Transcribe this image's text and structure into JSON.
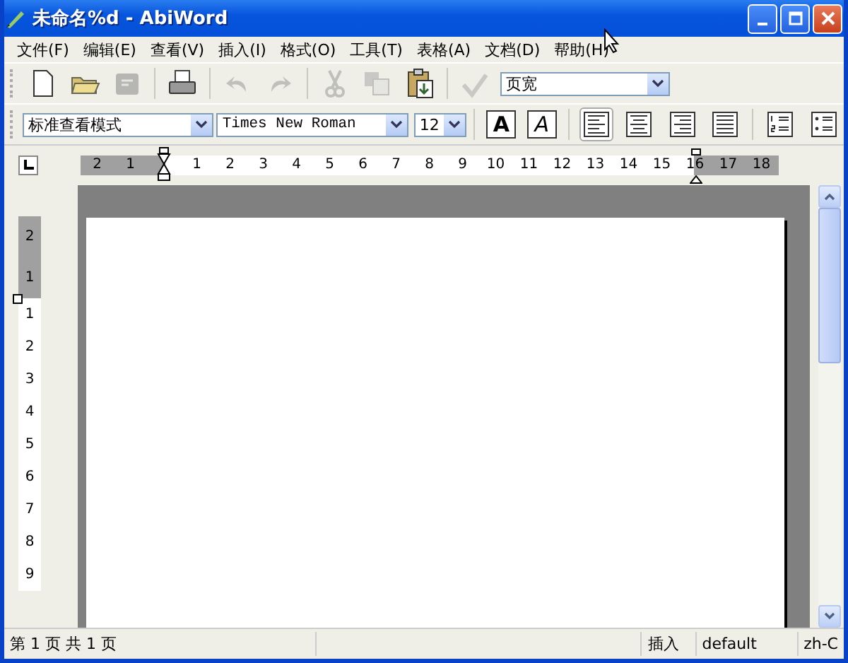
{
  "window": {
    "title": "未命名%d - AbiWord"
  },
  "menu": [
    {
      "label": "文件(F)"
    },
    {
      "label": "编辑(E)"
    },
    {
      "label": "查看(V)"
    },
    {
      "label": "插入(I)"
    },
    {
      "label": "格式(O)"
    },
    {
      "label": "工具(T)"
    },
    {
      "label": "表格(A)"
    },
    {
      "label": "文档(D)"
    },
    {
      "label": "帮助(H)"
    }
  ],
  "standard_toolbar": {
    "buttons": [
      {
        "kind": "new",
        "disabled": false
      },
      {
        "kind": "open",
        "disabled": false
      },
      {
        "kind": "save",
        "disabled": true
      },
      {
        "kind": "print",
        "disabled": false
      },
      {
        "kind": "undo",
        "disabled": true
      },
      {
        "kind": "redo",
        "disabled": true
      },
      {
        "kind": "cut",
        "disabled": true
      },
      {
        "kind": "copy",
        "disabled": true
      },
      {
        "kind": "paste",
        "disabled": false
      },
      {
        "kind": "spell",
        "disabled": true
      }
    ],
    "zoom": "页宽"
  },
  "format_toolbar": {
    "style": "标准查看模式",
    "font": "Times New Roman",
    "size": "12",
    "bold": "A",
    "italic": "A",
    "align": [
      {
        "kind": "left",
        "selected": true
      },
      {
        "kind": "center",
        "selected": false
      },
      {
        "kind": "right",
        "selected": false
      },
      {
        "kind": "justify",
        "selected": false
      }
    ],
    "lists": [
      {
        "kind": "numbered"
      },
      {
        "kind": "bulleted"
      }
    ]
  },
  "horizontal_ruler": {
    "before": [
      "2",
      "1"
    ],
    "after": [
      "1",
      "2",
      "3",
      "4",
      "5",
      "6",
      "7",
      "8",
      "9",
      "10",
      "11",
      "12",
      "13",
      "14",
      "15",
      "16",
      "17",
      "18"
    ]
  },
  "vertical_ruler": {
    "before": [
      "2",
      "1"
    ],
    "after": [
      "1",
      "2",
      "3",
      "4",
      "5",
      "6",
      "7",
      "8",
      "9"
    ]
  },
  "status_bar": {
    "page": "第 1 页 共 1 页",
    "mode": "插入",
    "style": "default",
    "language": "zh-C"
  }
}
